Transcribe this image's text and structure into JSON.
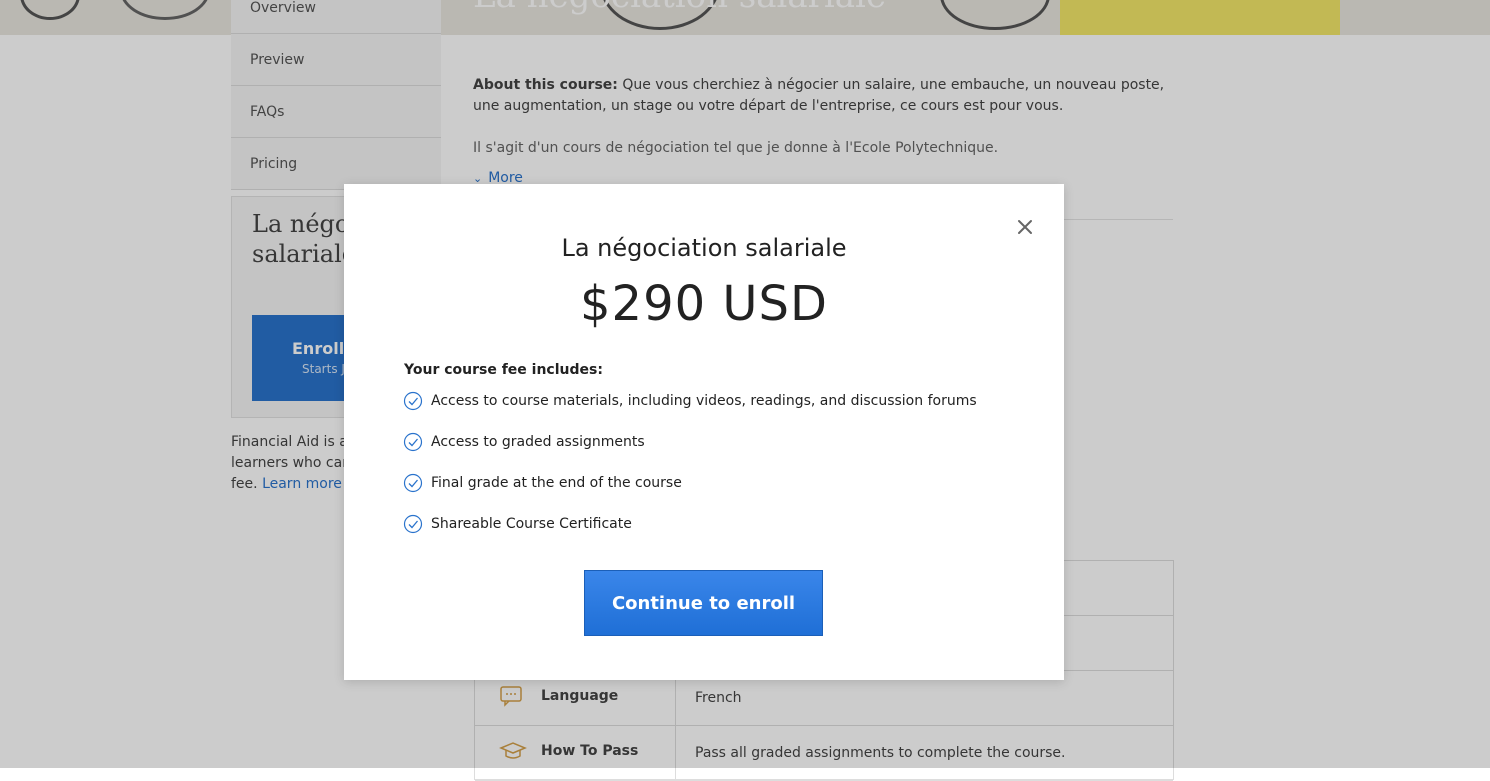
{
  "hero": {
    "title": "La négociation salariale"
  },
  "left_nav": {
    "items": [
      {
        "label": "Overview"
      },
      {
        "label": "Preview"
      },
      {
        "label": "FAQs"
      },
      {
        "label": "Pricing"
      }
    ]
  },
  "enroll_card": {
    "title": "La négociation salariale",
    "button_label": "Enroll",
    "button_sub": "Starts J"
  },
  "financial_aid": {
    "text": "Financial Aid is available for learners who can't afford the fee.",
    "link": "Learn more a"
  },
  "about": {
    "label": "About this course:",
    "text": " Que vous cherchiez à négocier un salaire, une embauche, un nouveau poste, une augmentation, un stage ou votre départ de l'entreprise, ce cours est pour vous.",
    "description": "Il s'agit d'un cours de négociation tel que je donne à l'Ecole Polytechnique.",
    "more": "More"
  },
  "info_table": {
    "rows": [
      {
        "label": "",
        "value": ""
      },
      {
        "label": "",
        "value": ""
      },
      {
        "label": "Language",
        "value": "French"
      },
      {
        "label": "How To Pass",
        "value": "Pass all graded assignments to complete the course."
      }
    ]
  },
  "modal": {
    "title": "La négociation salariale",
    "price": "$290 USD",
    "includes_heading": "Your course fee includes:",
    "features": [
      "Access to course materials, including videos, readings, and discussion forums",
      "Access to graded assignments",
      "Final grade at the end of the course",
      "Shareable Course Certificate"
    ],
    "continue_label": "Continue to enroll"
  },
  "colors": {
    "accent": "#2a73cc",
    "button": "#2a7ae2",
    "overlay": "rgba(0,0,0,0.2)"
  }
}
